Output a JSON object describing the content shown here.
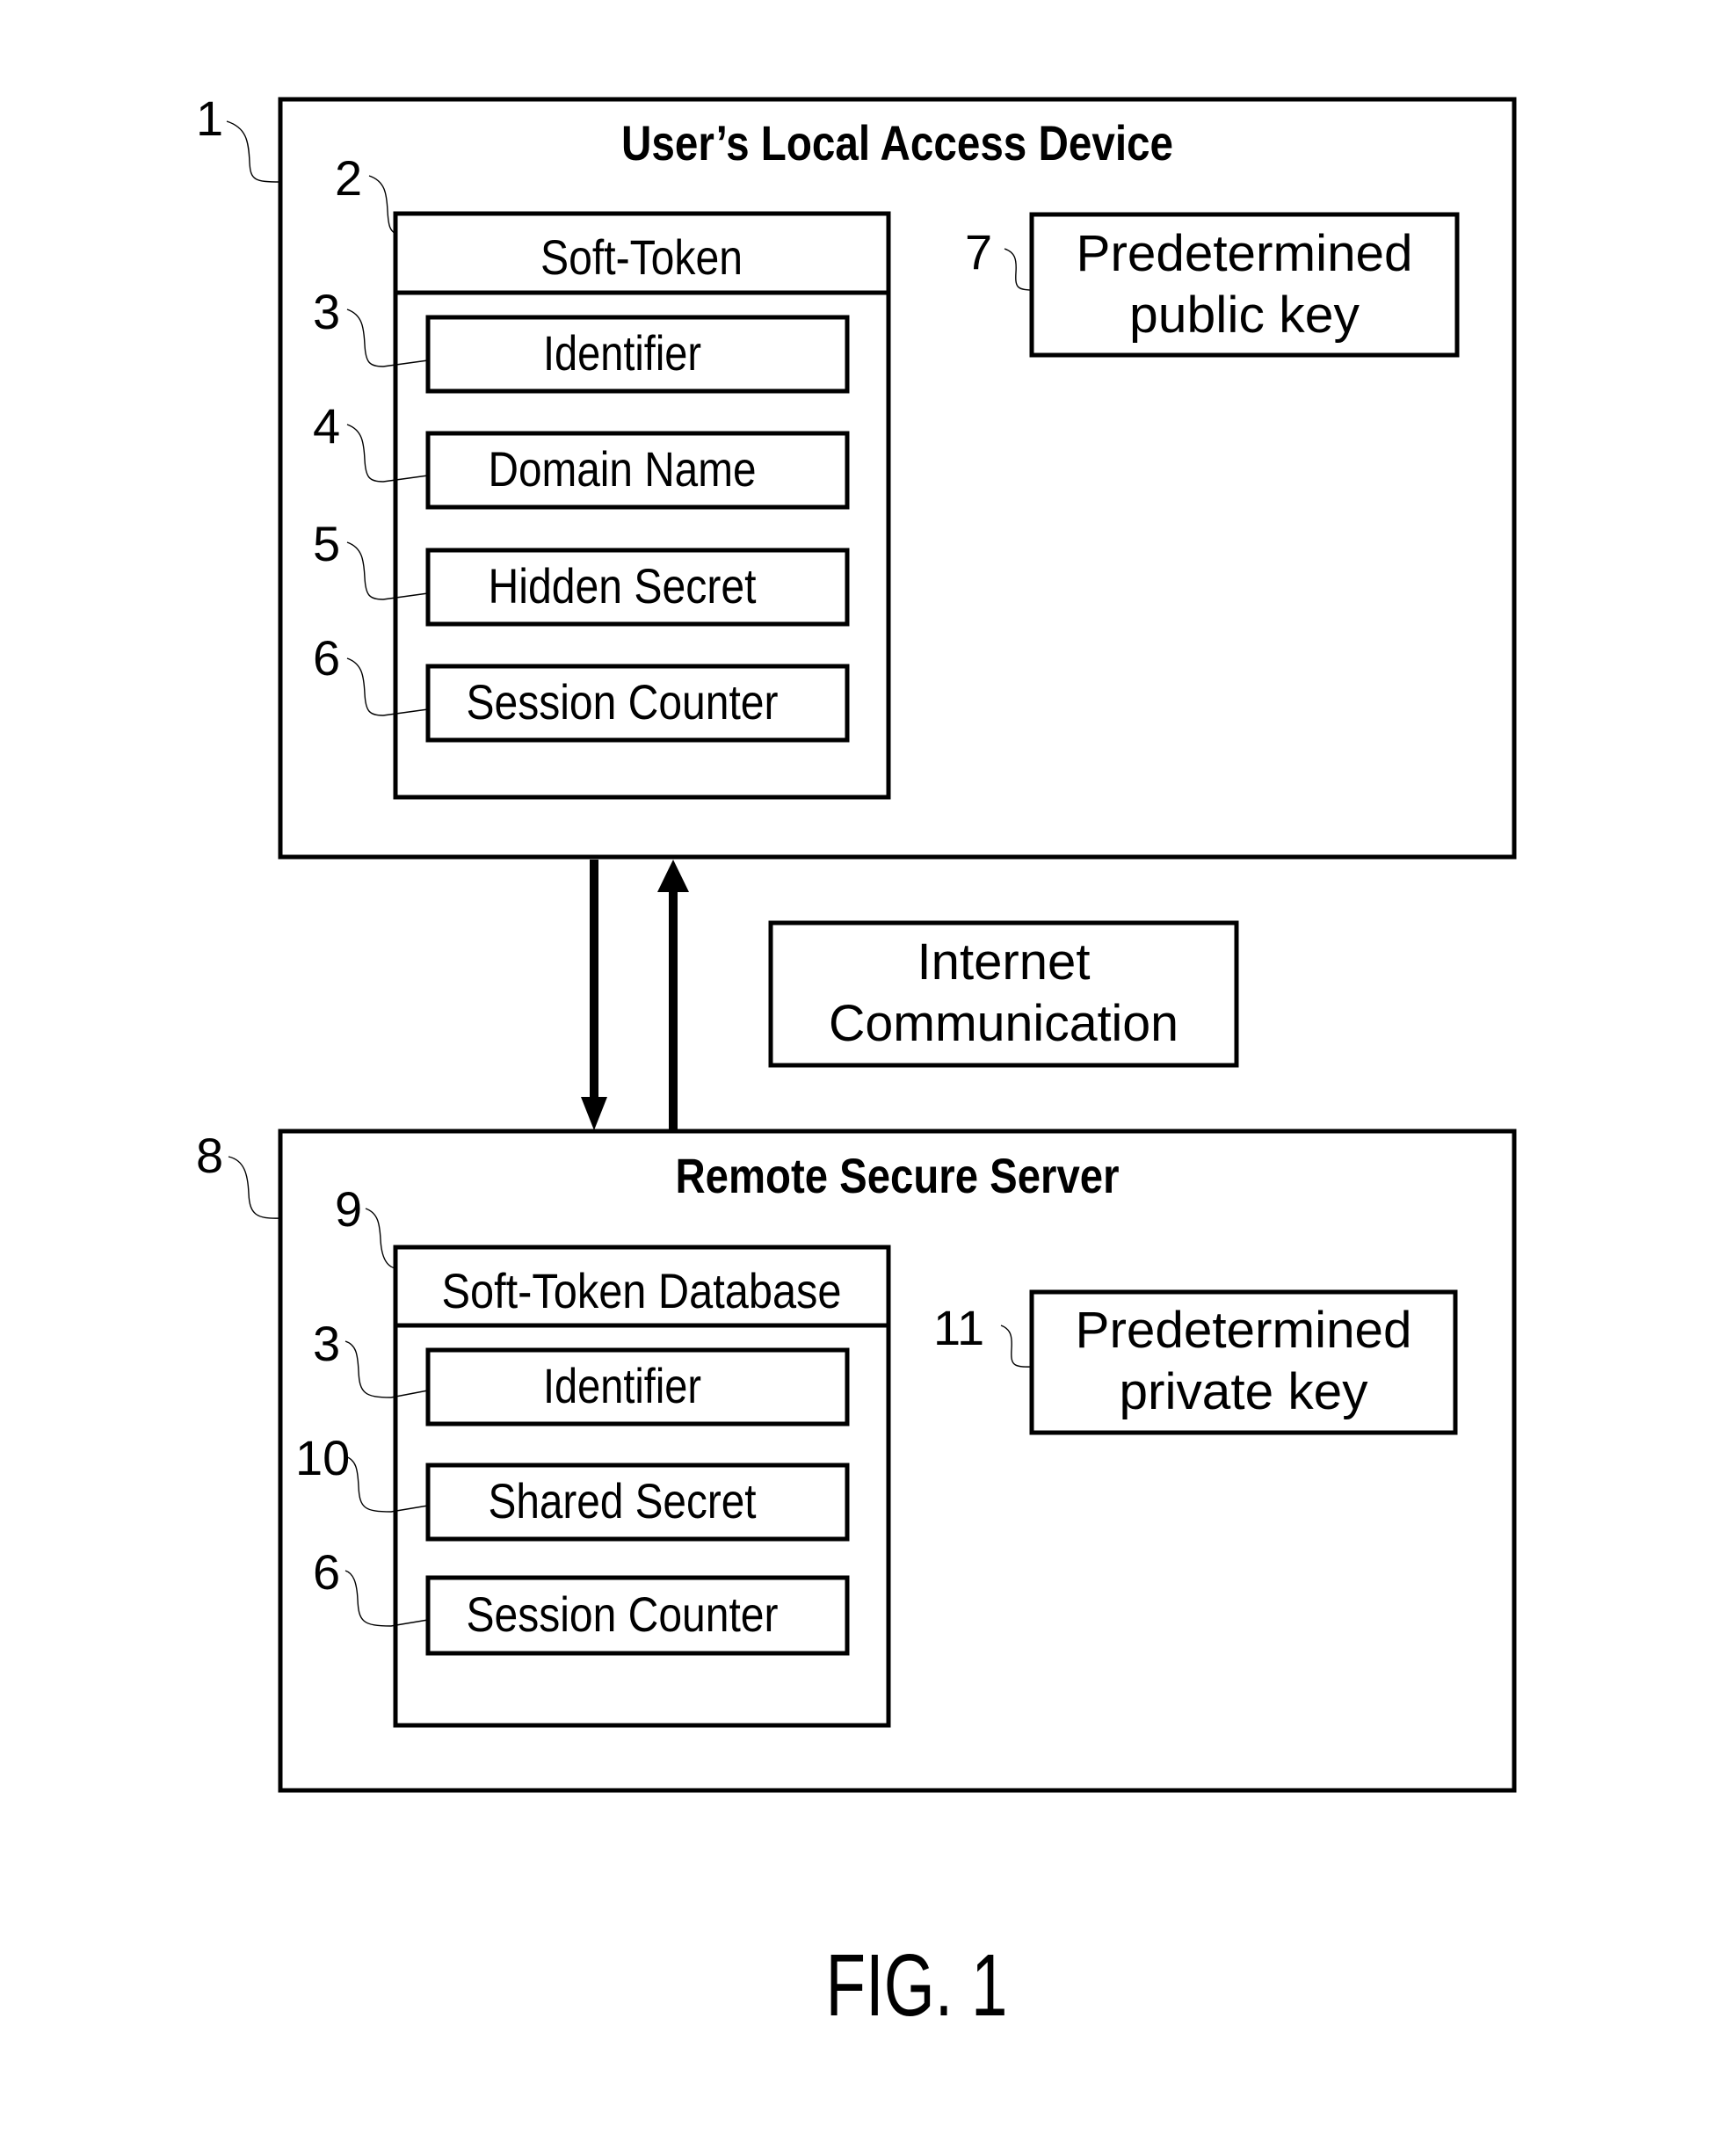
{
  "figure_label": "FIG. 1",
  "local_device": {
    "ref": "1",
    "title": "User’s Local Access Device",
    "soft_token": {
      "ref": "2",
      "header": "Soft-Token",
      "fields": [
        {
          "ref": "3",
          "label": "Identifier"
        },
        {
          "ref": "4",
          "label": "Domain Name"
        },
        {
          "ref": "5",
          "label": "Hidden Secret"
        },
        {
          "ref": "6",
          "label": "Session Counter"
        }
      ]
    },
    "key": {
      "ref": "7",
      "line1": "Predetermined",
      "line2": "public key"
    }
  },
  "channel": {
    "line1": "Internet",
    "line2": "Communication",
    "arrows": [
      "device-to-server",
      "server-to-device"
    ]
  },
  "server": {
    "ref": "8",
    "title": "Remote Secure Server",
    "database": {
      "ref": "9",
      "header": "Soft-Token Database",
      "fields": [
        {
          "ref": "3",
          "label": "Identifier"
        },
        {
          "ref": "10",
          "label": "Shared Secret"
        },
        {
          "ref": "6",
          "label": "Session Counter"
        }
      ]
    },
    "key": {
      "ref": "11",
      "line1": "Predetermined",
      "line2": "private key"
    }
  }
}
